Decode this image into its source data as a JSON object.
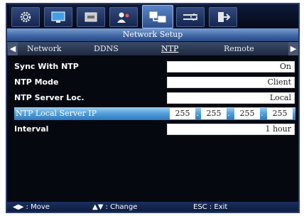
{
  "icons": [
    {
      "name": "gear-icon"
    },
    {
      "name": "monitor-icon"
    },
    {
      "name": "storage-icon"
    },
    {
      "name": "users-icon"
    },
    {
      "name": "network-icon",
      "active": true
    },
    {
      "name": "settings-slider-icon"
    },
    {
      "name": "exit-icon"
    }
  ],
  "title": "Network Setup",
  "tabs": [
    "Network",
    "DDNS",
    "NTP",
    "Remote"
  ],
  "active_tab": "NTP",
  "settings": {
    "sync_label": "Sync With NTP",
    "sync_value": "On",
    "mode_label": "NTP Mode",
    "mode_value": "Client",
    "server_label": "NTP Server Loc.",
    "server_value": "Local",
    "ip_label": "NTP Local Server IP",
    "ip_octets": [
      "255",
      "255",
      "255",
      "255"
    ],
    "interval_label": "Interval",
    "interval_value": "1 hour"
  },
  "footer": {
    "move": "◀▶ : Move",
    "change": "▲▼ : Change",
    "exit": "ESC : Exit"
  },
  "colors": {
    "selected_row": "#4f9ed8",
    "title_bar": "#3d63a2",
    "background": "#05080f"
  }
}
